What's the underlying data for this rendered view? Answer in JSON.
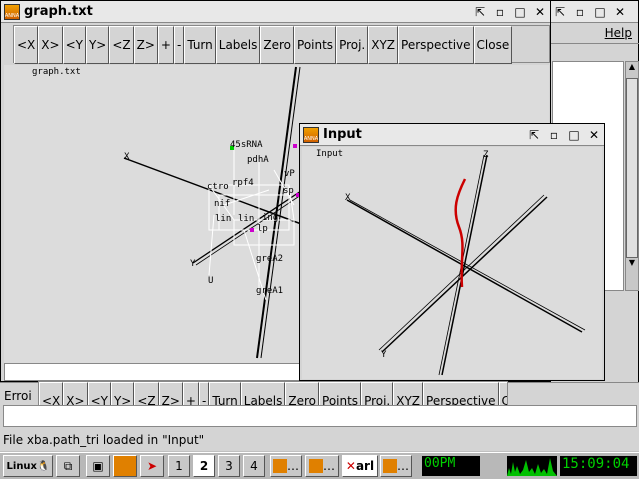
{
  "graph_window": {
    "title": "graph.txt",
    "toolbar": [
      "<X",
      "X>",
      "<Y",
      "Y>",
      "<Z",
      "Z>",
      "+",
      "-",
      "Turn",
      "Labels",
      "Zero",
      "Points",
      "Proj.",
      "XYZ",
      "Perspective",
      "Close"
    ],
    "canvas_label": "graph.txt",
    "axis_labels": {
      "x": "X",
      "y": "Y",
      "u": "U"
    },
    "node_labels": [
      "45sRNA",
      "pdhA",
      "rpf4",
      "ctro",
      "nif",
      "lin",
      "lin",
      "ing",
      "lp",
      "greA2",
      "greA1",
      "vP",
      "sp"
    ]
  },
  "input_window": {
    "title": "Input",
    "canvas_label": "Input",
    "axis_labels": {
      "x": "X",
      "y": "Y",
      "z": "Z"
    }
  },
  "bottom_panel": {
    "label": "Erroi",
    "toolbar": [
      "<X",
      "X>",
      "<Y",
      "Y>",
      "<Z",
      "Z>",
      "+",
      "-",
      "Turn",
      "Labels",
      "Zero",
      "Points",
      "Proj.",
      "XYZ",
      "Perspective",
      "Clos"
    ]
  },
  "right_window": {
    "help": "Help"
  },
  "status_text": "File xba.path_tri loaded in \"Input\"",
  "taskbar": {
    "start_label": "Linux",
    "desktops": [
      "1",
      "2",
      "3",
      "4"
    ],
    "app_x": "arl",
    "clock_label": "00PM",
    "time": "15:09:04"
  },
  "colors": {
    "accent_red": "#cc0000",
    "clock_green": "#00d000"
  }
}
